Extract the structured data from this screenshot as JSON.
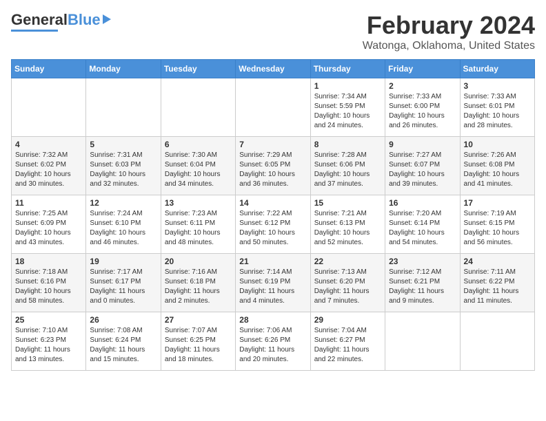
{
  "header": {
    "logo_general": "General",
    "logo_blue": "Blue",
    "month_title": "February 2024",
    "location": "Watonga, Oklahoma, United States"
  },
  "weekdays": [
    "Sunday",
    "Monday",
    "Tuesday",
    "Wednesday",
    "Thursday",
    "Friday",
    "Saturday"
  ],
  "weeks": [
    [
      {
        "day": "",
        "info": ""
      },
      {
        "day": "",
        "info": ""
      },
      {
        "day": "",
        "info": ""
      },
      {
        "day": "",
        "info": ""
      },
      {
        "day": "1",
        "info": "Sunrise: 7:34 AM\nSunset: 5:59 PM\nDaylight: 10 hours\nand 24 minutes."
      },
      {
        "day": "2",
        "info": "Sunrise: 7:33 AM\nSunset: 6:00 PM\nDaylight: 10 hours\nand 26 minutes."
      },
      {
        "day": "3",
        "info": "Sunrise: 7:33 AM\nSunset: 6:01 PM\nDaylight: 10 hours\nand 28 minutes."
      }
    ],
    [
      {
        "day": "4",
        "info": "Sunrise: 7:32 AM\nSunset: 6:02 PM\nDaylight: 10 hours\nand 30 minutes."
      },
      {
        "day": "5",
        "info": "Sunrise: 7:31 AM\nSunset: 6:03 PM\nDaylight: 10 hours\nand 32 minutes."
      },
      {
        "day": "6",
        "info": "Sunrise: 7:30 AM\nSunset: 6:04 PM\nDaylight: 10 hours\nand 34 minutes."
      },
      {
        "day": "7",
        "info": "Sunrise: 7:29 AM\nSunset: 6:05 PM\nDaylight: 10 hours\nand 36 minutes."
      },
      {
        "day": "8",
        "info": "Sunrise: 7:28 AM\nSunset: 6:06 PM\nDaylight: 10 hours\nand 37 minutes."
      },
      {
        "day": "9",
        "info": "Sunrise: 7:27 AM\nSunset: 6:07 PM\nDaylight: 10 hours\nand 39 minutes."
      },
      {
        "day": "10",
        "info": "Sunrise: 7:26 AM\nSunset: 6:08 PM\nDaylight: 10 hours\nand 41 minutes."
      }
    ],
    [
      {
        "day": "11",
        "info": "Sunrise: 7:25 AM\nSunset: 6:09 PM\nDaylight: 10 hours\nand 43 minutes."
      },
      {
        "day": "12",
        "info": "Sunrise: 7:24 AM\nSunset: 6:10 PM\nDaylight: 10 hours\nand 46 minutes."
      },
      {
        "day": "13",
        "info": "Sunrise: 7:23 AM\nSunset: 6:11 PM\nDaylight: 10 hours\nand 48 minutes."
      },
      {
        "day": "14",
        "info": "Sunrise: 7:22 AM\nSunset: 6:12 PM\nDaylight: 10 hours\nand 50 minutes."
      },
      {
        "day": "15",
        "info": "Sunrise: 7:21 AM\nSunset: 6:13 PM\nDaylight: 10 hours\nand 52 minutes."
      },
      {
        "day": "16",
        "info": "Sunrise: 7:20 AM\nSunset: 6:14 PM\nDaylight: 10 hours\nand 54 minutes."
      },
      {
        "day": "17",
        "info": "Sunrise: 7:19 AM\nSunset: 6:15 PM\nDaylight: 10 hours\nand 56 minutes."
      }
    ],
    [
      {
        "day": "18",
        "info": "Sunrise: 7:18 AM\nSunset: 6:16 PM\nDaylight: 10 hours\nand 58 minutes."
      },
      {
        "day": "19",
        "info": "Sunrise: 7:17 AM\nSunset: 6:17 PM\nDaylight: 11 hours\nand 0 minutes."
      },
      {
        "day": "20",
        "info": "Sunrise: 7:16 AM\nSunset: 6:18 PM\nDaylight: 11 hours\nand 2 minutes."
      },
      {
        "day": "21",
        "info": "Sunrise: 7:14 AM\nSunset: 6:19 PM\nDaylight: 11 hours\nand 4 minutes."
      },
      {
        "day": "22",
        "info": "Sunrise: 7:13 AM\nSunset: 6:20 PM\nDaylight: 11 hours\nand 7 minutes."
      },
      {
        "day": "23",
        "info": "Sunrise: 7:12 AM\nSunset: 6:21 PM\nDaylight: 11 hours\nand 9 minutes."
      },
      {
        "day": "24",
        "info": "Sunrise: 7:11 AM\nSunset: 6:22 PM\nDaylight: 11 hours\nand 11 minutes."
      }
    ],
    [
      {
        "day": "25",
        "info": "Sunrise: 7:10 AM\nSunset: 6:23 PM\nDaylight: 11 hours\nand 13 minutes."
      },
      {
        "day": "26",
        "info": "Sunrise: 7:08 AM\nSunset: 6:24 PM\nDaylight: 11 hours\nand 15 minutes."
      },
      {
        "day": "27",
        "info": "Sunrise: 7:07 AM\nSunset: 6:25 PM\nDaylight: 11 hours\nand 18 minutes."
      },
      {
        "day": "28",
        "info": "Sunrise: 7:06 AM\nSunset: 6:26 PM\nDaylight: 11 hours\nand 20 minutes."
      },
      {
        "day": "29",
        "info": "Sunrise: 7:04 AM\nSunset: 6:27 PM\nDaylight: 11 hours\nand 22 minutes."
      },
      {
        "day": "",
        "info": ""
      },
      {
        "day": "",
        "info": ""
      }
    ]
  ]
}
